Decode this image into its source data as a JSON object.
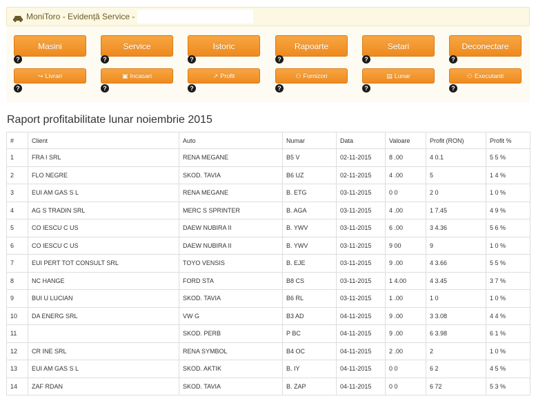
{
  "header": {
    "title": "MoniToro - Evidență Service -",
    "input_value": ""
  },
  "nav_main": [
    {
      "label": "Masini"
    },
    {
      "label": "Service"
    },
    {
      "label": "Istoric"
    },
    {
      "label": "Rapoarte"
    },
    {
      "label": "Setari"
    },
    {
      "label": "Deconectare"
    }
  ],
  "nav_sub": [
    {
      "label": "Livrari",
      "icon": "exit-icon"
    },
    {
      "label": "Incasari",
      "icon": "money-icon"
    },
    {
      "label": "Profit",
      "icon": "chart-icon"
    },
    {
      "label": "Furnizori",
      "icon": "group-icon"
    },
    {
      "label": "Lunar",
      "icon": "file-icon"
    },
    {
      "label": "Executanti",
      "icon": "person-icon"
    }
  ],
  "help_glyph": "?",
  "report": {
    "title": "Raport profitabilitate lunar noiembrie 2015",
    "columns": [
      "#",
      "Client",
      "Auto",
      "Numar",
      "Data",
      "Valoare",
      "Profit (RON)",
      "Profit %"
    ],
    "rows": [
      [
        "1",
        "FRA      I SRL",
        "RENA      MEGANE",
        "B5      V",
        "02-11-2015",
        "8      .00",
        "4      0.1",
        "5   5 %"
      ],
      [
        "2",
        "FLO      NEGRE",
        "SKOD.      TAVIA",
        "B6      UZ",
        "02-11-2015",
        "4      .00",
        "5",
        "1   4 %"
      ],
      [
        "3",
        "EUI      AM GAS S      L",
        "RENA      MEGANE",
        "B.      ETG",
        "03-11-2015",
        "0      0",
        "2      0",
        "1   0 %"
      ],
      [
        "4",
        "AG      S TRADIN      SRL",
        "MERC      S SPRINTER",
        "B.      AGA",
        "03-11-2015",
        "4      .00",
        "1      7.45",
        "4   9 %"
      ],
      [
        "5",
        "CO      IESCU C      US",
        "DAEW      NUBIRA II",
        "B.      YWV",
        "03-11-2015",
        "6      .00",
        "3      4.36",
        "5   6 %"
      ],
      [
        "6",
        "CO      IESCU C      US",
        "DAEW      NUBIRA II",
        "B.      YWV",
        "03-11-2015",
        "9      00",
        "9",
        "1   0 %"
      ],
      [
        "7",
        "EUI      PERT TOT      CONSULT SRL",
        "TOYO      VENSIS",
        "B.      EJE",
        "03-11-2015",
        "9      .00",
        "4      3.66",
        "5   5 %"
      ],
      [
        "8",
        "NC      HANGE",
        "FORD      STA",
        "B8      CS",
        "03-11-2015",
        "1      4.00",
        "4      3.45",
        "3   7 %"
      ],
      [
        "9",
        "BUI      U LUCIAN",
        "SKOD.      TAVIA",
        "B6      RL",
        "03-11-2015",
        "1      .00",
        "1      0",
        "1   0 %"
      ],
      [
        "10",
        "DA      ENERG      SRL",
        "VW G",
        "B3      AD",
        "04-11-2015",
        "9      .00",
        "3      3.08",
        "4   4 %"
      ],
      [
        "11",
        "",
        "SKOD.      PERB",
        "P      BC",
        "04-11-2015",
        "9      .00",
        "6      3.98",
        "6   1 %"
      ],
      [
        "12",
        "CR      INE SRL",
        "RENA      SYMBOL",
        "B4      OC",
        "04-11-2015",
        "2      .00",
        "2",
        "1   0 %"
      ],
      [
        "13",
        "EUI      AM GAS S      L",
        "SKOD.      AKTIK",
        "B.      IY",
        "04-11-2015",
        "0      0",
        "6      2",
        "4   5 %"
      ],
      [
        "14",
        "ZAF      RDAN",
        "SKOD.      TAVIA",
        "B.      ZAP",
        "04-11-2015",
        "0      0",
        "6      72",
        "5   3 %"
      ]
    ]
  },
  "colors": {
    "accent": "#f29a2e",
    "topbar_bg": "#fcf8e3",
    "help_bg": "#1a1a1a"
  }
}
